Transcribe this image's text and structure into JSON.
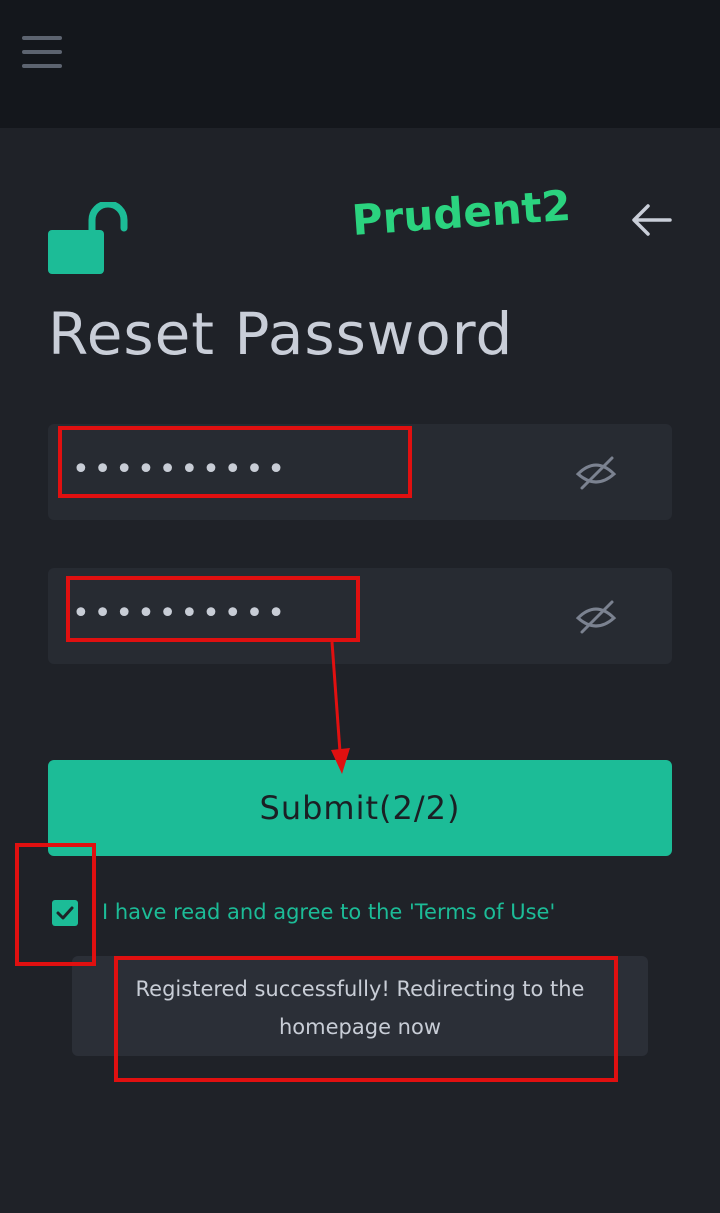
{
  "header": {
    "menu_icon": "hamburger-menu-icon"
  },
  "watermark": "Prudent2",
  "page": {
    "title": "Reset Password",
    "lock_icon": "unlocked-padlock-icon",
    "back_icon": "arrow-left-icon"
  },
  "form": {
    "new_password": {
      "value": "••••••••••",
      "toggle_icon": "eye-off-icon"
    },
    "confirm_password": {
      "value": "••••••••••",
      "toggle_icon": "eye-off-icon"
    },
    "submit_label": "Submit(2/2)",
    "terms": {
      "checked": true,
      "label": "I have read and agree to the 'Terms of Use'"
    }
  },
  "toast": {
    "message": "Registered successfully! Redirecting to the homepage now"
  },
  "colors": {
    "accent": "#1cbc97",
    "background": "#1f2228",
    "topbar": "#14171c",
    "watermark": "#2bd37f",
    "annotation": "#e01010"
  }
}
